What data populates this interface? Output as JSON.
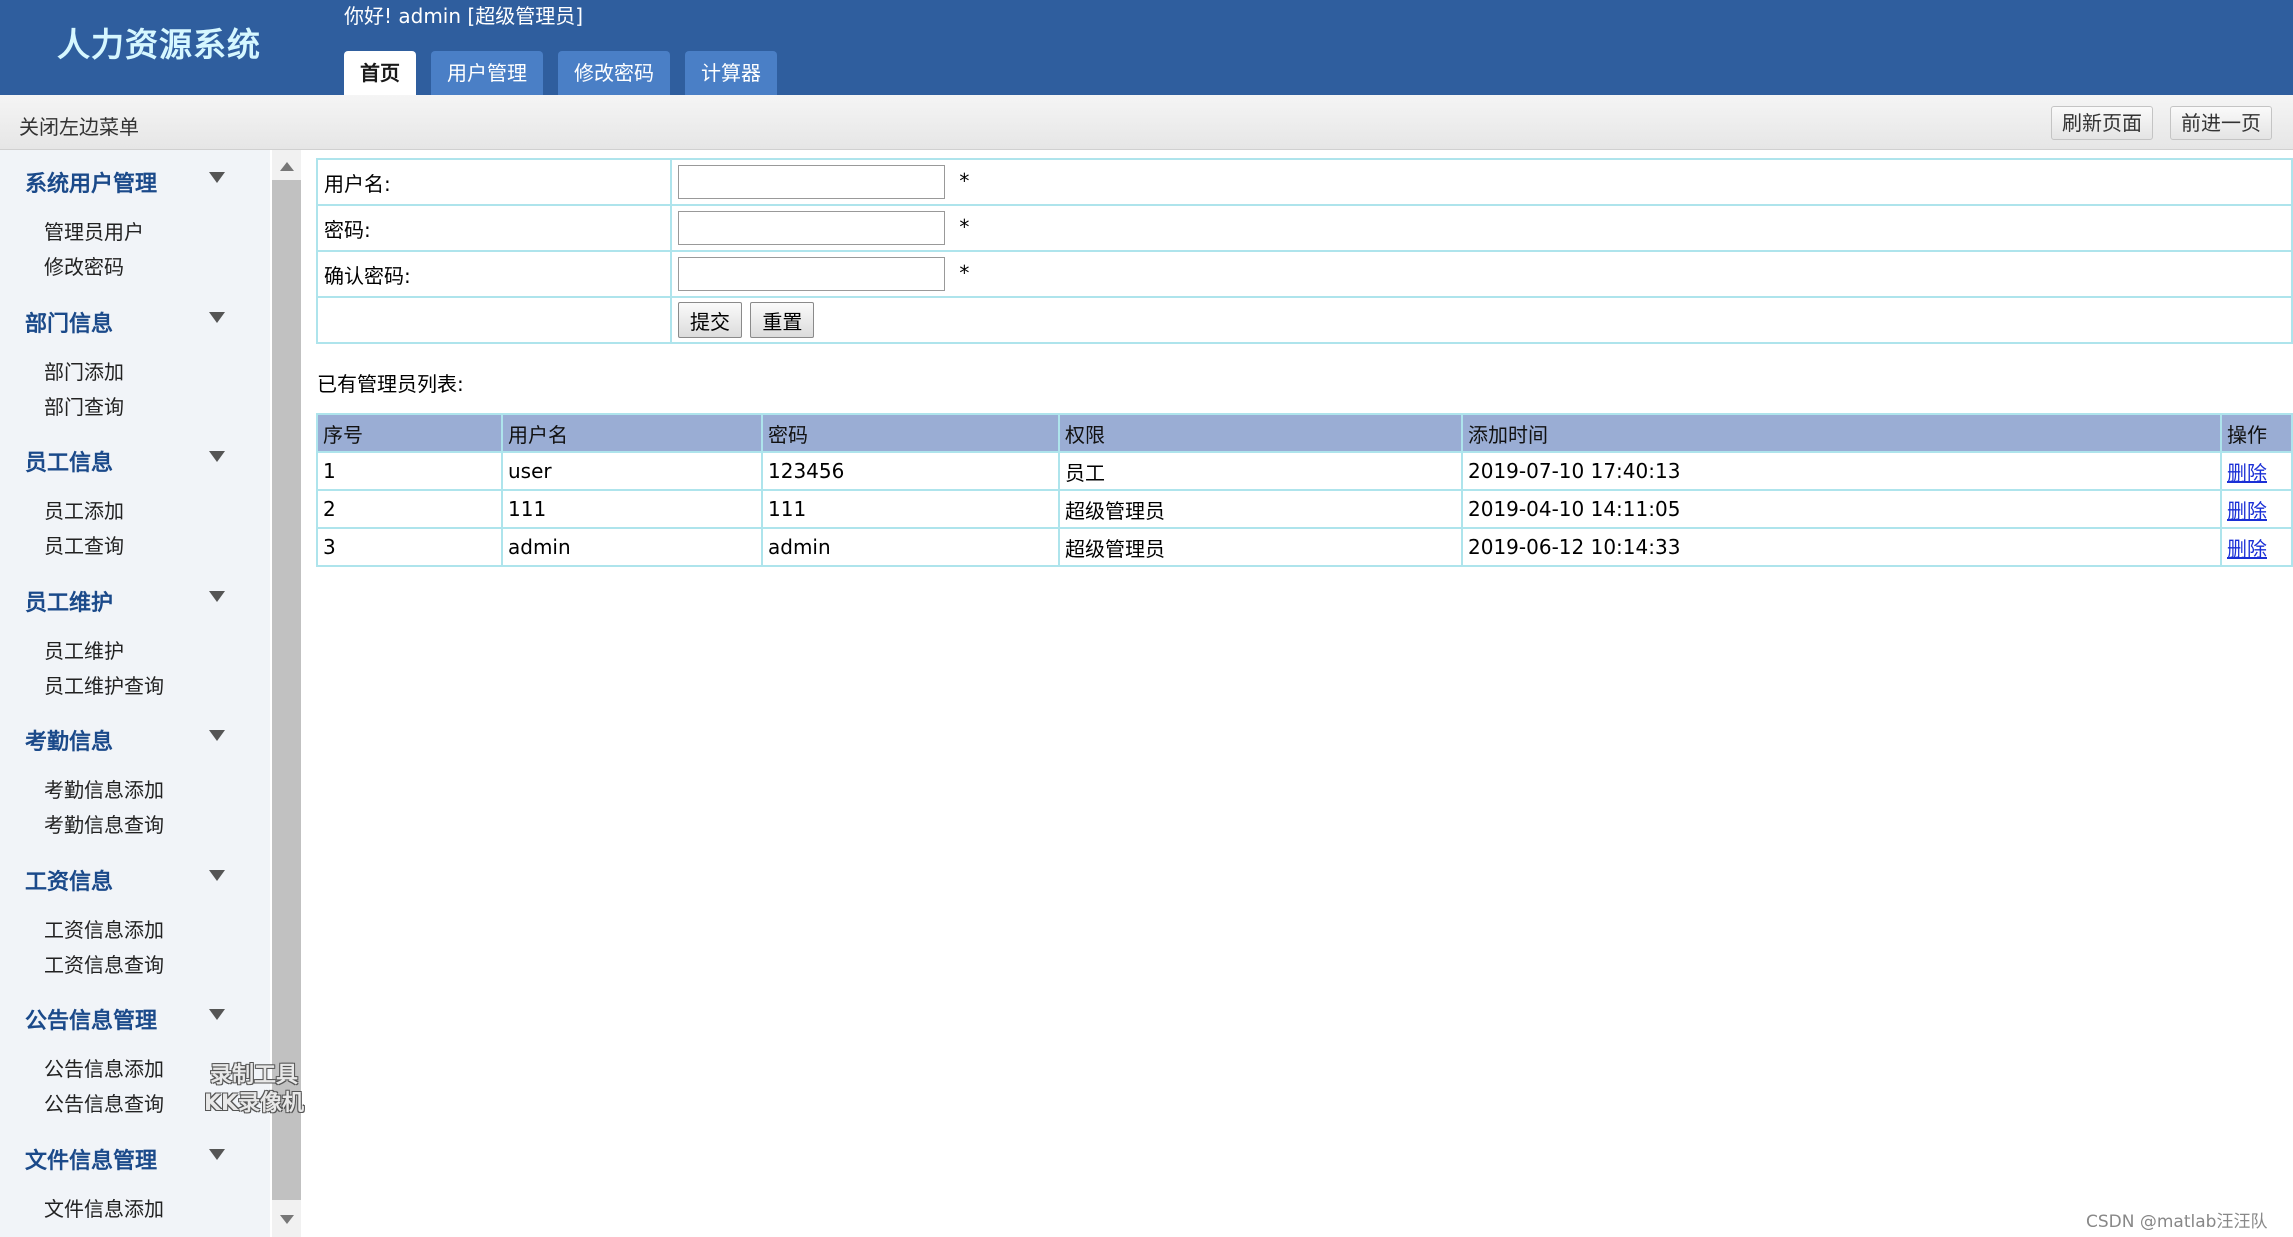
{
  "header": {
    "app_title": "人力资源系统",
    "greeting": "你好!  admin [超级管理员]",
    "tabs": [
      {
        "label": "首页"
      },
      {
        "label": "用户管理"
      },
      {
        "label": "修改密码"
      },
      {
        "label": "计算器"
      }
    ],
    "active_tab": "首页"
  },
  "subbar": {
    "toggle_menu_label": "关闭左边菜单",
    "refresh_label": "刷新页面",
    "forward_label": "前进一页"
  },
  "sidebar": {
    "groups": [
      {
        "title": "系统用户管理",
        "items": [
          "管理员用户",
          "修改密码"
        ]
      },
      {
        "title": "部门信息",
        "items": [
          "部门添加",
          "部门查询"
        ]
      },
      {
        "title": "员工信息",
        "items": [
          "员工添加",
          "员工查询"
        ]
      },
      {
        "title": "员工维护",
        "items": [
          "员工维护",
          "员工维护查询"
        ]
      },
      {
        "title": "考勤信息",
        "items": [
          "考勤信息添加",
          "考勤信息查询"
        ]
      },
      {
        "title": "工资信息",
        "items": [
          "工资信息添加",
          "工资信息查询"
        ]
      },
      {
        "title": "公告信息管理",
        "items": [
          "公告信息添加",
          "公告信息查询"
        ]
      },
      {
        "title": "文件信息管理",
        "items": [
          "文件信息添加",
          ""
        ]
      }
    ]
  },
  "form": {
    "username_label": "用户名:",
    "password_label": "密码:",
    "confirm_label": "确认密码:",
    "username_value": "",
    "password_value": "",
    "confirm_value": "",
    "required_mark": "*",
    "submit_label": "提交",
    "reset_label": "重置"
  },
  "list": {
    "title": "已有管理员列表:",
    "columns": [
      "序号",
      "用户名",
      "密码",
      "权限",
      "添加时间",
      "操作"
    ],
    "rows": [
      [
        "1",
        "user",
        "123456",
        "员工",
        "2019-07-10 17:40:13",
        "删除"
      ],
      [
        "2",
        "111",
        "111",
        "超级管理员",
        "2019-04-10 14:11:05",
        "删除"
      ],
      [
        "3",
        "admin",
        "admin",
        "超级管理员",
        "2019-06-12 10:14:33",
        "删除"
      ]
    ]
  },
  "watermarks": {
    "recorder_line1": "录制工具",
    "recorder_line2": "KK录像机",
    "csdn": "CSDN @matlab汪汪队"
  },
  "colors": {
    "header_bg": "#2f5e9e",
    "tab_bg": "#4a7fc6",
    "table_header_bg": "#9aadd4",
    "table_border": "#aee4ec",
    "sidebar_heading": "#1b4a8a"
  }
}
